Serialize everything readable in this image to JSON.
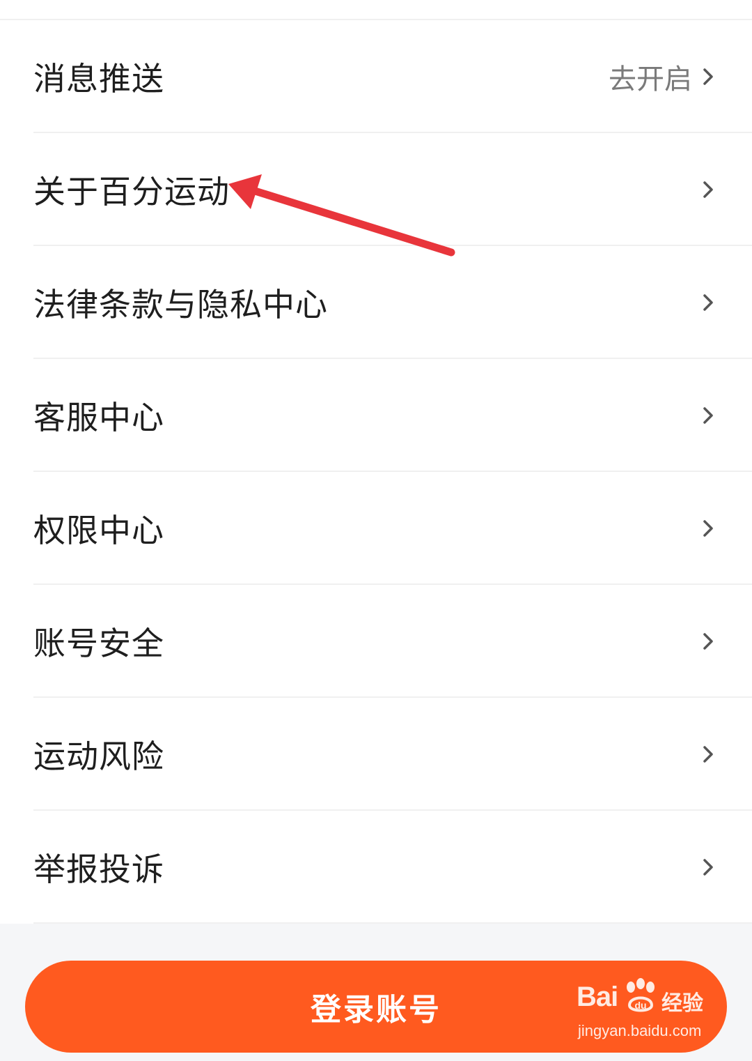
{
  "settings_list": {
    "items": [
      {
        "label": "消息推送",
        "value": "去开启"
      },
      {
        "label": "关于百分运动",
        "value": ""
      },
      {
        "label": "法律条款与隐私中心",
        "value": ""
      },
      {
        "label": "客服中心",
        "value": ""
      },
      {
        "label": "权限中心",
        "value": ""
      },
      {
        "label": "账号安全",
        "value": ""
      },
      {
        "label": "运动风险",
        "value": ""
      },
      {
        "label": "举报投诉",
        "value": ""
      }
    ]
  },
  "login": {
    "label": "登录账号"
  },
  "colors": {
    "accent": "#ff5a1f",
    "annotation_arrow": "#e8353b"
  },
  "watermark": {
    "brand_prefix": "Bai",
    "brand_suffix": "经验",
    "url": "jingyan.baidu.com"
  }
}
